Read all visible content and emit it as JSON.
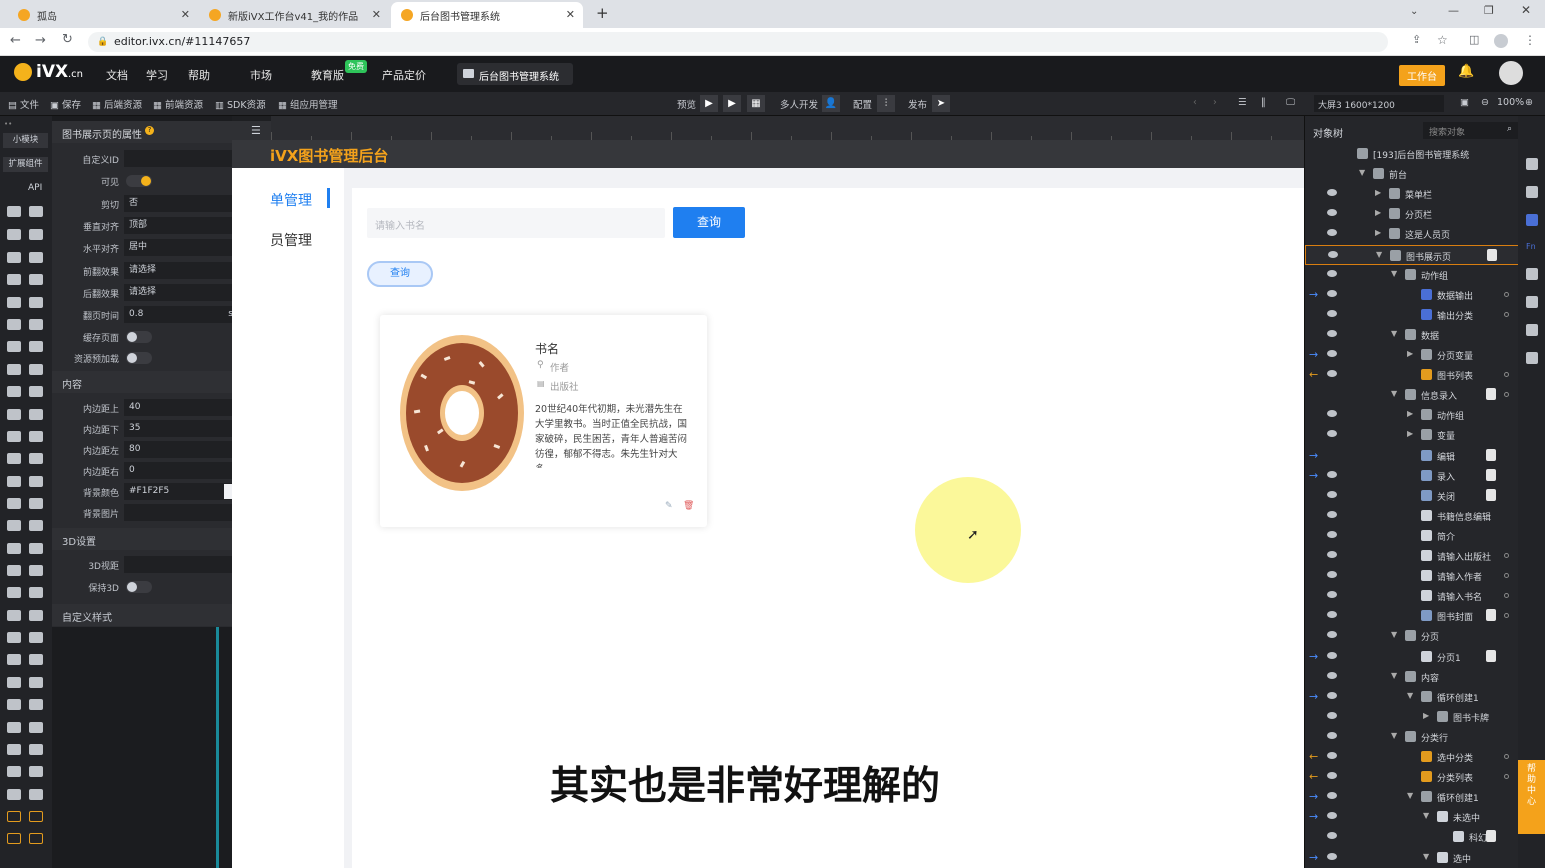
{
  "browser": {
    "tabs": [
      {
        "label": "孤岛",
        "active": false
      },
      {
        "label": "新版iVX工作台v41_我的作品",
        "active": false
      },
      {
        "label": "后台图书管理系统",
        "active": true
      }
    ],
    "new_tab_label": "+",
    "url": "editor.ivx.cn/#11147657"
  },
  "menubar": {
    "logo": "iVX",
    "logo_suffix": ".cn",
    "items": [
      "文档",
      "学习",
      "帮助",
      "市场",
      "教育版",
      "产品定价"
    ],
    "free_badge": "免费",
    "project_tab": "后台图书管理系统",
    "workspace_button": "工作台"
  },
  "toolbar": {
    "left_items": [
      "文件",
      "保存",
      "后端资源",
      "前端资源",
      "SDK资源",
      "组应用管理"
    ],
    "center_items": [
      "预览",
      "多人开发",
      "配置",
      "发布"
    ],
    "screen_size": "大屏3 1600*1200",
    "zoom": "100%"
  },
  "icon_column": {
    "tabs": [
      "小模块",
      "扩展组件"
    ],
    "api_label": "API"
  },
  "props_panel": {
    "title": "图书展示页的属性",
    "rows": [
      {
        "label": "自定义ID",
        "value": ""
      },
      {
        "label": "可见",
        "value": "toggle-on"
      },
      {
        "label": "剪切",
        "value": "否"
      },
      {
        "label": "垂直对齐",
        "value": "顶部"
      },
      {
        "label": "水平对齐",
        "value": "居中"
      },
      {
        "label": "前翻效果",
        "value": "请选择"
      },
      {
        "label": "后翻效果",
        "value": "请选择"
      },
      {
        "label": "翻页时间",
        "value": "0.8",
        "unit": "s"
      },
      {
        "label": "缓存页面",
        "value": "toggle-off"
      },
      {
        "label": "资源预加载",
        "value": "toggle-off"
      }
    ],
    "section_content": "内容",
    "content_rows": [
      {
        "label": "内边距上",
        "value": "40"
      },
      {
        "label": "内边距下",
        "value": "35"
      },
      {
        "label": "内边距左",
        "value": "80"
      },
      {
        "label": "内边距右",
        "value": "0"
      },
      {
        "label": "背景颜色",
        "value": "#F1F2F5"
      },
      {
        "label": "背景图片",
        "value": ""
      }
    ],
    "section_3d": "3D设置",
    "rows_3d": [
      {
        "label": "3D视距",
        "value": ""
      },
      {
        "label": "保持3D",
        "value": "toggle-off"
      }
    ],
    "section_custom": "自定义样式",
    "section_custom_add": "+"
  },
  "canvas": {
    "app_title": "iVX图书管理后台",
    "side_menu": [
      "单管理",
      "员管理"
    ],
    "search_placeholder": "请输入书名",
    "search_button": "查询",
    "pill_button": "查询",
    "book": {
      "name": "书名",
      "author": "作者",
      "publisher": "出版社",
      "description": "20世纪40年代初期，未光潜先生在大学里教书。当时正值全民抗战，国家破碎，民生困苦，青年人普遍苦闷彷徨，郁郁不得志。朱先生针对大多..."
    },
    "subtitle": "其实也是非常好理解的"
  },
  "tree": {
    "header": "对象树",
    "search_placeholder": "搜索对象",
    "nodes": [
      {
        "label": "[193]后台图书管理系统",
        "indent": 0,
        "color": "#9aa0a6"
      },
      {
        "label": "前台",
        "indent": 1,
        "color": "#9aa0a6"
      },
      {
        "label": "菜单栏",
        "indent": 2,
        "color": "#9aa0a6"
      },
      {
        "label": "分页栏",
        "indent": 2,
        "color": "#9aa0a6"
      },
      {
        "label": "这是人员页",
        "indent": 2,
        "color": "#9aa0a6"
      },
      {
        "label": "图书展示页",
        "indent": 2,
        "color": "#9aa0a6",
        "selected": true
      },
      {
        "label": "动作组",
        "indent": 3,
        "color": "#9aa0a6"
      },
      {
        "label": "数据输出",
        "indent": 4,
        "color": "#4a6fd6"
      },
      {
        "label": "输出分类",
        "indent": 4,
        "color": "#4a6fd6"
      },
      {
        "label": "数据",
        "indent": 3,
        "color": "#9aa0a6"
      },
      {
        "label": "分页变量",
        "indent": 4,
        "color": "#9aa0a6"
      },
      {
        "label": "图书列表",
        "indent": 4,
        "color": "#e39b1e"
      },
      {
        "label": "信息录入",
        "indent": 3,
        "color": "#9aa0a6"
      },
      {
        "label": "动作组",
        "indent": 4,
        "color": "#9aa0a6"
      },
      {
        "label": "变量",
        "indent": 4,
        "color": "#9aa0a6"
      },
      {
        "label": "编辑",
        "indent": 4,
        "color": "#7f9ac4"
      },
      {
        "label": "录入",
        "indent": 4,
        "color": "#7f9ac4"
      },
      {
        "label": "关闭",
        "indent": 4,
        "color": "#7f9ac4"
      },
      {
        "label": "书籍信息编辑",
        "indent": 4,
        "color": "#cfd3da"
      },
      {
        "label": "简介",
        "indent": 4,
        "color": "#cfd3da"
      },
      {
        "label": "请输入出版社",
        "indent": 4,
        "color": "#cfd3da"
      },
      {
        "label": "请输入作者",
        "indent": 4,
        "color": "#cfd3da"
      },
      {
        "label": "请输入书名",
        "indent": 4,
        "color": "#cfd3da"
      },
      {
        "label": "图书封面",
        "indent": 4,
        "color": "#7f9ac4"
      },
      {
        "label": "分页",
        "indent": 3,
        "color": "#9aa0a6"
      },
      {
        "label": "分页1",
        "indent": 4,
        "color": "#cfd3da"
      },
      {
        "label": "内容",
        "indent": 3,
        "color": "#9aa0a6"
      },
      {
        "label": "循环创建1",
        "indent": 4,
        "color": "#9aa0a6"
      },
      {
        "label": "图书卡牌",
        "indent": 5,
        "color": "#9aa0a6"
      },
      {
        "label": "分类行",
        "indent": 3,
        "color": "#9aa0a6"
      },
      {
        "label": "选中分类",
        "indent": 4,
        "color": "#e39b1e"
      },
      {
        "label": "分类列表",
        "indent": 4,
        "color": "#e39b1e"
      },
      {
        "label": "循环创建1",
        "indent": 4,
        "color": "#9aa0a6"
      },
      {
        "label": "未选中",
        "indent": 5,
        "color": "#cfd3da"
      },
      {
        "label": "科幻",
        "indent": 6,
        "color": "#cfd3da"
      },
      {
        "label": "选中",
        "indent": 5,
        "color": "#cfd3da"
      }
    ]
  },
  "help_button": "帮助中心",
  "colors": {
    "accent": "#f4b21b",
    "primary_button": "#1f7ff0",
    "canvas_bg": "#F1F2F5",
    "tree_selected": "#d97e10"
  }
}
